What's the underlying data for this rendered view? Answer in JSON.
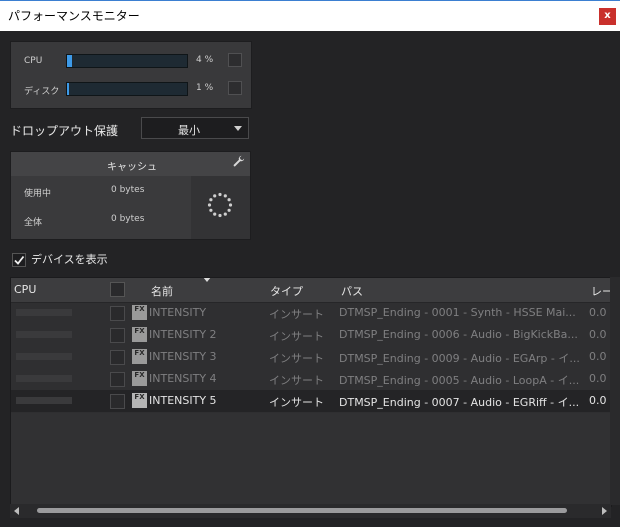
{
  "window": {
    "title": "パフォーマンスモニター",
    "close_label": "x"
  },
  "meters": [
    {
      "label": "CPU",
      "value": "4 %",
      "level": 0.04
    },
    {
      "label": "ディスク",
      "value": "1 %",
      "level": 0.01
    }
  ],
  "dropout": {
    "label": "ドロップアウト保護",
    "selected": "最小"
  },
  "cache": {
    "title": "キャッシュ",
    "rows": [
      {
        "label": "使用中",
        "value": "0 bytes"
      },
      {
        "label": "全体",
        "value": "0 bytes"
      }
    ]
  },
  "show_devices": {
    "label": "デバイスを表示",
    "checked": true
  },
  "table": {
    "columns": {
      "cpu": "CPU",
      "name": "名前",
      "type": "タイプ",
      "path": "パス",
      "latency": "レー"
    },
    "fx_badge": "FX",
    "rows": [
      {
        "name": "INTENSITY",
        "type": "インサート",
        "path": "DTMSP_Ending - 0001 - Synth - HSSE Mai...",
        "latency": "0.0 ("
      },
      {
        "name": "INTENSITY 2",
        "type": "インサート",
        "path": "DTMSP_Ending - 0006 - Audio - BigKickBa...",
        "latency": "0.0 ("
      },
      {
        "name": "INTENSITY 3",
        "type": "インサート",
        "path": "DTMSP_Ending - 0009 - Audio - EGArp - イ...",
        "latency": "0.0 ("
      },
      {
        "name": "INTENSITY 4",
        "type": "インサート",
        "path": "DTMSP_Ending - 0005 - Audio - LoopA - イ...",
        "latency": "0.0 ("
      },
      {
        "name": "INTENSITY 5",
        "type": "インサート",
        "path": "DTMSP_Ending - 0007 - Audio - EGRiff - イ...",
        "latency": "0.0 ("
      }
    ]
  },
  "colors": {
    "accent": "#3d9ae8",
    "close": "#c9302c",
    "background": "#232325"
  }
}
